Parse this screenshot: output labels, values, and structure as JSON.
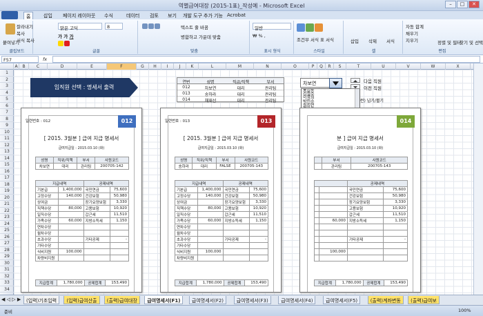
{
  "window": {
    "title": "역별급여대장 (2015-1표)_작성예 - Microsoft Excel"
  },
  "ribbon_tabs": [
    "홈",
    "삽입",
    "페이지 레이아웃",
    "수식",
    "데이터",
    "검토",
    "보기",
    "개발 도구",
    "추가 기능",
    "Acrobat"
  ],
  "ribbon": {
    "clipboard": {
      "paste": "붙여넣기",
      "cut": "잘라내기",
      "copy": "복사",
      "format_painter": "서식 복사",
      "label": "클립보드"
    },
    "font": {
      "name": "맑은 고딕",
      "size": "8",
      "label": "글꼴"
    },
    "align": {
      "wrap": "텍스트 줄 바꿈",
      "merge": "병합하고 가운데 맞춤",
      "label": "맞춤"
    },
    "number": {
      "format": "일반",
      "label": "표시 형식"
    },
    "styles": {
      "cond": "조건부 서식",
      "table": "표 서식",
      "cell": "셀 스타일",
      "label": "스타일"
    },
    "cells": {
      "insert": "삽입",
      "delete": "삭제",
      "format": "서식",
      "label": "셀"
    },
    "editing": {
      "autosum": "자동 합계",
      "fill": "채우기",
      "clear": "지우기",
      "sort": "정렬 및 필터",
      "find": "찾기 및 선택",
      "label": "편집"
    }
  },
  "namebox": "F57",
  "columns": [
    "A",
    "B",
    "C",
    "D",
    "E",
    "F",
    "G",
    "H",
    "I",
    "J",
    "K",
    "L",
    "M",
    "N",
    "O",
    "P",
    "Q",
    "R",
    "S",
    "T",
    "U",
    "V",
    "W",
    "X"
  ],
  "rows": [
    "1",
    "2",
    "3",
    "4",
    "5",
    "6",
    "7",
    "8",
    "9",
    "10",
    "11",
    "12",
    "13",
    "14",
    "15",
    "16",
    "17",
    "18",
    "19",
    "20",
    "21",
    "22",
    "23",
    "24",
    "25",
    "26",
    "27",
    "28",
    "29",
    "30",
    "31",
    "32",
    "33",
    "34"
  ],
  "banner": "임직원 선택 : 명세서 출력",
  "mini_table": {
    "headers": [
      "연번",
      "성명",
      "직급/직책",
      "부서"
    ],
    "rows": [
      [
        "012",
        "차보연",
        "대리",
        "관리팀"
      ],
      [
        "013",
        "송하라",
        "대리",
        "관리팀"
      ],
      [
        "014",
        "채재선",
        "대리",
        "관리팀"
      ]
    ]
  },
  "dropdown": {
    "value": "차보연",
    "items": [
      "홍길동",
      "김철수",
      "이영희",
      "박민수",
      "최지현",
      "정하늘",
      "강다은",
      "조현우",
      "윤서연",
      "장민호",
      "임수정",
      "한지민",
      "오세훈",
      "서지수",
      "신동욱",
      "권나래",
      "황보석",
      "안재민",
      "송지효",
      "류승범",
      "전지현",
      "홍진경",
      "고아라",
      "문채원",
      "양동근",
      "손예진",
      "배수지",
      "백진희",
      "허가윤",
      "남궁민",
      "노홍철",
      "하석진",
      "곽도원",
      "성유리",
      "차보연",
      "송하라",
      "채재선",
      "유재석",
      "김종국",
      "이광수",
      "지석진",
      "전소민",
      "양세찬",
      "하하",
      "송지은",
      "김민지",
      "박서준",
      "이도현",
      "정유미",
      "최우식",
      "김다미",
      "한소희",
      "박보검",
      "이준기",
      "김태리",
      "남주혁",
      "신세경",
      "정해인",
      "김고은",
      "공유"
    ],
    "highlight_index": 34
  },
  "spinner": {
    "next": "다음 직원",
    "prev": "이전 직원"
  },
  "right_note": "런) 넘기/펼기",
  "stubs": [
    {
      "no": "일련번호 : 012",
      "badge": "012",
      "badge_color": "#3f6fbf",
      "title": "[ 2015. 3월분 ] 급여 지급 명세서",
      "date": "급여지급일 : 2015.03.10 (화)",
      "info_headers": [
        "성명",
        "직위/직책",
        "부서",
        "사원코드"
      ],
      "info": [
        "차보연",
        "대리",
        "관리팀",
        "200705-142"
      ],
      "pay": {
        "head_left": "지급내역",
        "head_right": "공제내역",
        "rows": [
          [
            "기본급",
            "1,400,000",
            "국민연금",
            "75,600"
          ],
          [
            "고정수당",
            "140,000",
            "건강보험",
            "50,980"
          ],
          [
            "상여금",
            "",
            "장기요양보험",
            "3,330"
          ],
          [
            "직책수당",
            "80,000",
            "고용보험",
            "10,920"
          ],
          [
            "일직수당",
            "",
            "갑근세",
            "11,510"
          ],
          [
            "가족수당",
            "60,000",
            "지방소득세",
            "1,150"
          ],
          [
            "연차수당",
            "",
            "",
            ""
          ],
          [
            "월차수당",
            "",
            "",
            ""
          ],
          [
            "초과수당",
            "",
            "기타공제",
            "-"
          ],
          [
            "기타수당",
            "",
            "",
            ""
          ],
          [
            "식비지원",
            "100,000",
            "",
            ""
          ],
          [
            "차량비지원",
            "",
            "",
            ""
          ]
        ],
        "total_left_label": "지급합계",
        "total_left": "1,780,000",
        "total_right_label": "공제합계",
        "total_right": "153,490"
      }
    },
    {
      "no": "일련번호 : 013",
      "badge": "013",
      "badge_color": "#b3262a",
      "title": "[ 2015. 3월분 ] 급여 지급 명세서",
      "date": "급여지급일 : 2015.03.10 (화)",
      "info_headers": [
        "성명",
        "직위/직책",
        "부서",
        "사원코드"
      ],
      "info": [
        "송하라",
        "대리",
        "FALSE",
        "200705-143"
      ],
      "pay": {
        "head_left": "지급내역",
        "head_right": "공제내역",
        "rows": [
          [
            "기본급",
            "1,400,000",
            "국민연금",
            "75,600"
          ],
          [
            "고정수당",
            "140,000",
            "건강보험",
            "50,980"
          ],
          [
            "상여금",
            "",
            "장기요양보험",
            "3,330"
          ],
          [
            "직책수당",
            "80,000",
            "고용보험",
            "10,920"
          ],
          [
            "일직수당",
            "",
            "갑근세",
            "11,510"
          ],
          [
            "가족수당",
            "60,000",
            "지방소득세",
            "1,150"
          ],
          [
            "연차수당",
            "",
            "",
            ""
          ],
          [
            "월차수당",
            "",
            "",
            ""
          ],
          [
            "초과수당",
            "",
            "기타공제",
            "-"
          ],
          [
            "기타수당",
            "",
            "",
            ""
          ],
          [
            "식비지원",
            "100,000",
            "",
            ""
          ],
          [
            "차량비지원",
            "",
            "",
            ""
          ]
        ],
        "total_left_label": "지급합계",
        "total_left": "1,780,000",
        "total_right_label": "공제합계",
        "total_right": "153,490"
      }
    },
    {
      "no": "",
      "badge": "014",
      "badge_color": "#7ea83a",
      "title": "분 ] 급여 지급 명세서",
      "date": "급여지급일 : 2015.03.10 (화)",
      "info_headers": [
        "",
        "부서",
        "사원코드"
      ],
      "info": [
        "",
        "관리팀",
        "200705-143"
      ],
      "pay": {
        "head_left": "",
        "head_right": "공제내역",
        "rows": [
          [
            "",
            "",
            "국민연금",
            "75,600"
          ],
          [
            "",
            "",
            "건강보험",
            "50,980"
          ],
          [
            "",
            "",
            "장기요양보험",
            "3,330"
          ],
          [
            "",
            "",
            "고용보험",
            "10,920"
          ],
          [
            "",
            "",
            "갑근세",
            "11,510"
          ],
          [
            "",
            "60,000",
            "지방소득세",
            "1,150"
          ],
          [
            "",
            "",
            "",
            ""
          ],
          [
            "",
            "",
            "",
            ""
          ],
          [
            "",
            "",
            "기타공제",
            "-"
          ],
          [
            "",
            "",
            "",
            ""
          ],
          [
            "",
            "100,000",
            "",
            ""
          ],
          [
            "",
            "",
            "",
            ""
          ]
        ],
        "total_left_label": "지급합계",
        "total_left": "1,780,000",
        "total_right_label": "공제합계",
        "total_right": "153,490"
      }
    }
  ],
  "sheet_tabs": [
    "(입력)기초입력",
    "(입력)급여산출",
    "(출력)급여대장",
    "급여명세서(F1)",
    "급여명세서(F2)",
    "급여명세서(F3)",
    "급여명세서(F4)",
    "급여명세서(F5)",
    "(출력)계좌변동",
    "(출력)급여보"
  ],
  "status_bar": {
    "ready": "준비",
    "zoom": "100%"
  }
}
